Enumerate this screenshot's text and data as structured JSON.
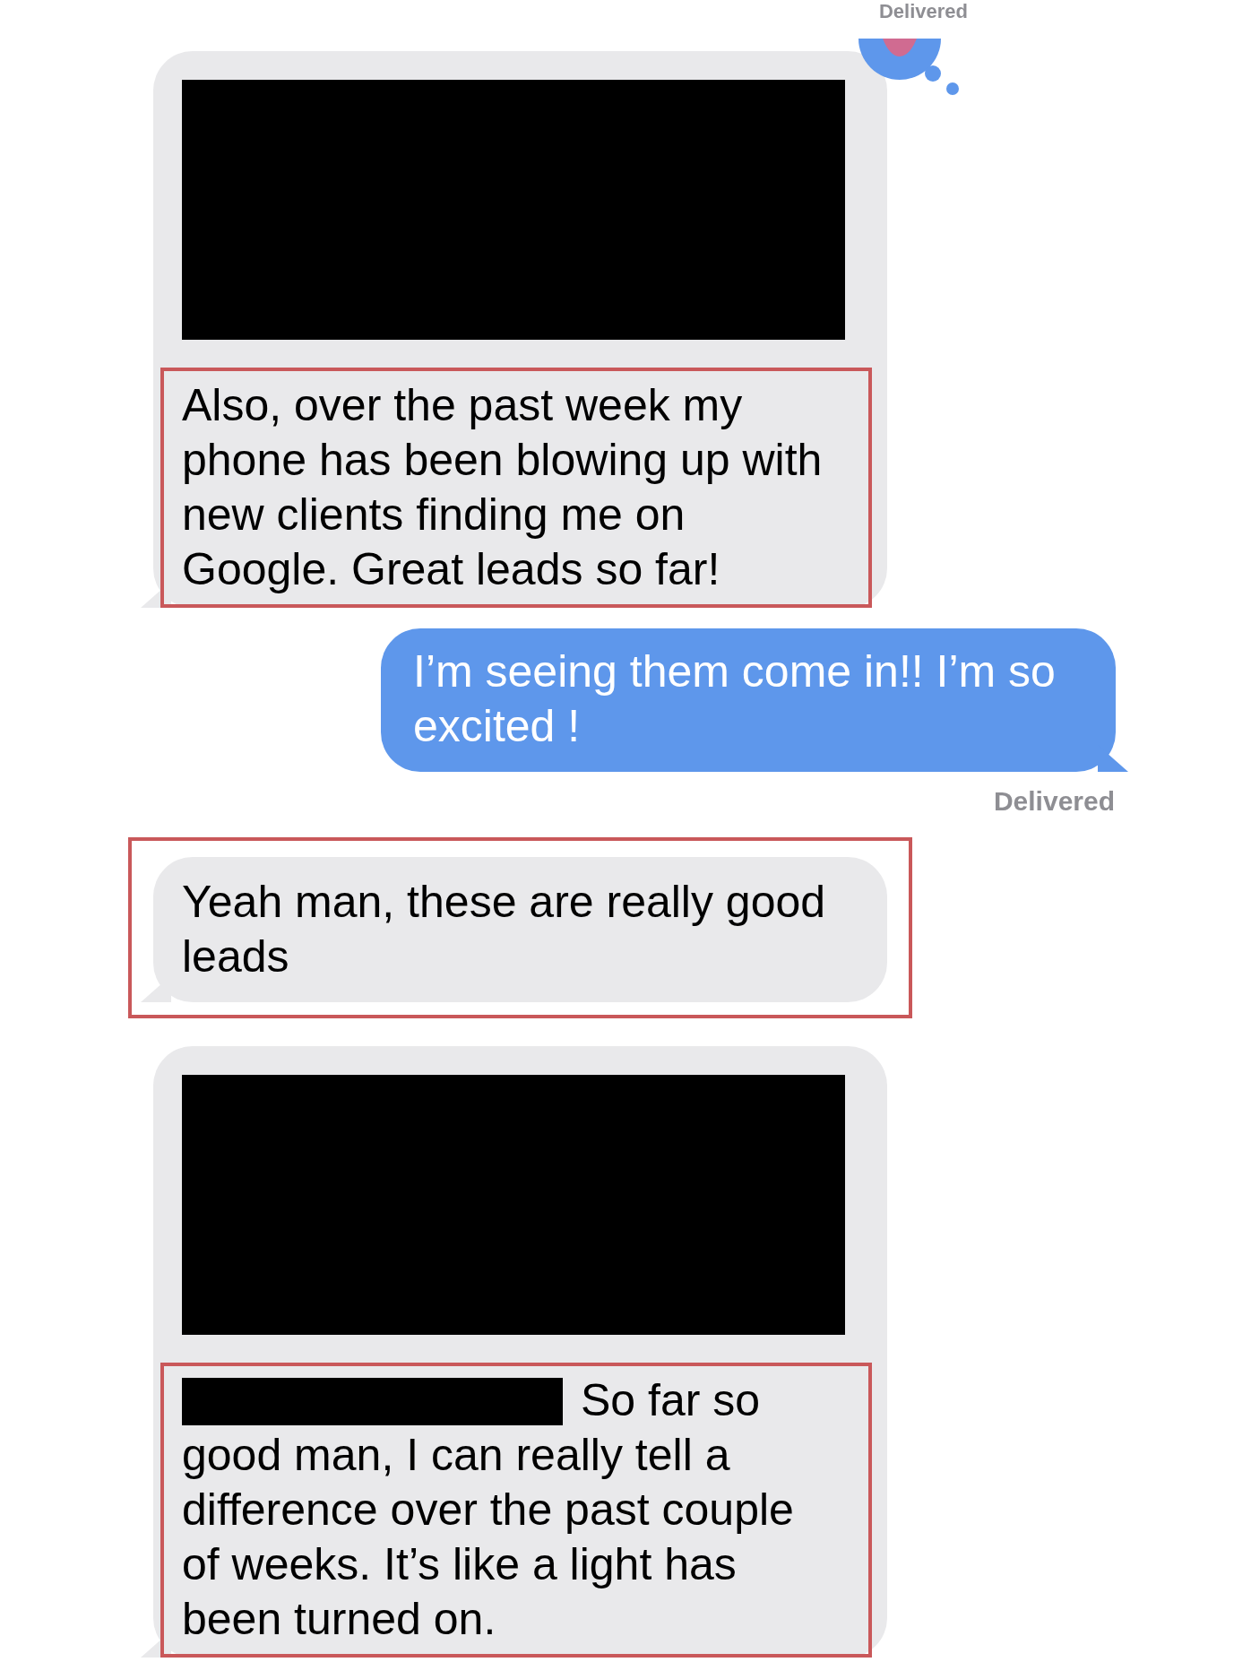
{
  "messages": [
    {
      "kind": "status",
      "text": "Delivered"
    },
    {
      "kind": "incoming",
      "sticker": true,
      "parts": [
        {
          "kind": "redaction"
        },
        {
          "kind": "text",
          "highlighted": true,
          "text": "Also, over the past week my phone has been blowing up with new clients finding me on Google. Great leads so far!"
        }
      ]
    },
    {
      "kind": "outgoing",
      "parts": [
        {
          "kind": "text",
          "text": "I’m seeing them come in!! I’m so excited !"
        }
      ]
    },
    {
      "kind": "status",
      "text": "Delivered"
    },
    {
      "kind": "incoming",
      "highlighted": true,
      "parts": [
        {
          "kind": "text",
          "text": "Yeah man, these are really good leads"
        }
      ]
    },
    {
      "kind": "incoming",
      "parts": [
        {
          "kind": "redaction"
        },
        {
          "kind": "text",
          "highlighted": true,
          "redacted_start": true,
          "text": "So far so good man, I can really tell a difference over the past couple of weeks. It’s like a light has been turned on."
        }
      ]
    }
  ]
}
